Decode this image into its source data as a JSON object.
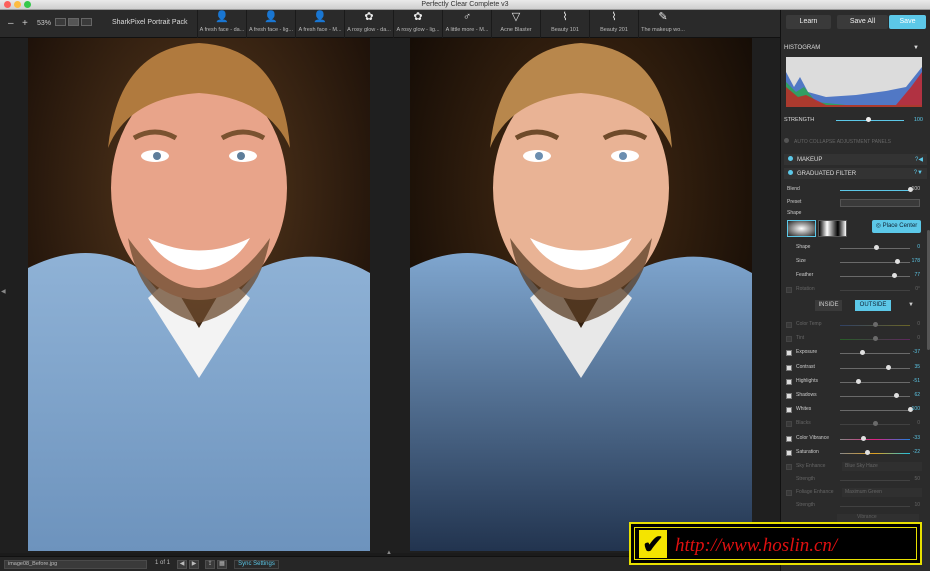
{
  "window": {
    "title": "Perfectly Clear Complete v3"
  },
  "toolbar": {
    "minus": "–",
    "plus": "+",
    "zoom": "53%",
    "pack": "SharkPixel Portrait Pack"
  },
  "presets": [
    {
      "icon": "person-icon",
      "label": "A fresh face - da..."
    },
    {
      "icon": "person-icon",
      "label": "A fresh face - lig..."
    },
    {
      "icon": "person-icon",
      "label": "A fresh face - M..."
    },
    {
      "icon": "flower-icon",
      "label": "A rosy glow - da..."
    },
    {
      "icon": "flower-icon",
      "label": "A rosy glow - lig..."
    },
    {
      "icon": "male-icon",
      "label": "A little more - M..."
    },
    {
      "icon": "blaster-icon",
      "label": "Acne Blaster"
    },
    {
      "icon": "brush-icon",
      "label": "Beauty 101"
    },
    {
      "icon": "brush-icon",
      "label": "Beauty 201"
    },
    {
      "icon": "makeup-icon",
      "label": "The makeup wo..."
    }
  ],
  "actions": {
    "learn": "Learn",
    "save_all": "Save All",
    "save": "Save"
  },
  "panel": {
    "histogram": "HISTOGRAM",
    "strength_label": "STRENGTH",
    "strength_value": "100",
    "auto_collapse": "AUTO COLLAPSE ADJUSTMENT PANELS",
    "makeup": "MAKEUP",
    "graduated_filter": "GRADUATED FILTER",
    "blend_label": "Blend",
    "blend_value": "100",
    "preset_label": "Preset",
    "shape_label": "Shape",
    "place_center": "Place Center",
    "shape": {
      "label": "Shape",
      "value": "0"
    },
    "size": {
      "label": "Size",
      "value": "178"
    },
    "feather": {
      "label": "Feather",
      "value": "77"
    },
    "rotation": {
      "label": "Rotation",
      "value": "0°"
    },
    "inside": "INSIDE",
    "outside": "OUTSIDE",
    "adjustments": [
      {
        "label": "Color Temp",
        "value": "0",
        "on": false,
        "pos": 0.5
      },
      {
        "label": "Tint",
        "value": "0",
        "on": false,
        "pos": 0.5
      },
      {
        "label": "Exposure",
        "value": "-37",
        "on": true,
        "pos": 0.32
      },
      {
        "label": "Contrast",
        "value": "35",
        "on": true,
        "pos": 0.68
      },
      {
        "label": "Highlights",
        "value": "-51",
        "on": true,
        "pos": 0.25
      },
      {
        "label": "Shadows",
        "value": "62",
        "on": true,
        "pos": 0.8
      },
      {
        "label": "Whites",
        "value": "100",
        "on": true,
        "pos": 1.0
      },
      {
        "label": "Blacks",
        "value": "0",
        "on": false,
        "pos": 0.5
      },
      {
        "label": "Color Vibrance",
        "value": "-33",
        "on": true,
        "pos": 0.33
      },
      {
        "label": "Saturation",
        "value": "-22",
        "on": true,
        "pos": 0.39
      }
    ],
    "sky_enhance": "Sky Enhance",
    "sky_value": "Blue Sky Haze",
    "sky_strength": "Strength",
    "sky_strength_value": "50",
    "foliage": "Foliage Enhance",
    "foliage_value": "Maximum Green",
    "foliage_strength": "Strength",
    "foliage_strength_value": "10",
    "vibrant": "Vibrance",
    "open_apps": "Open Apps Launcher"
  },
  "status": {
    "filename": "image08_Before.jpg",
    "page": "1 of 1",
    "sync": "Sync Settings"
  },
  "watermark": {
    "text": "http://www.hoslin.cn/"
  }
}
